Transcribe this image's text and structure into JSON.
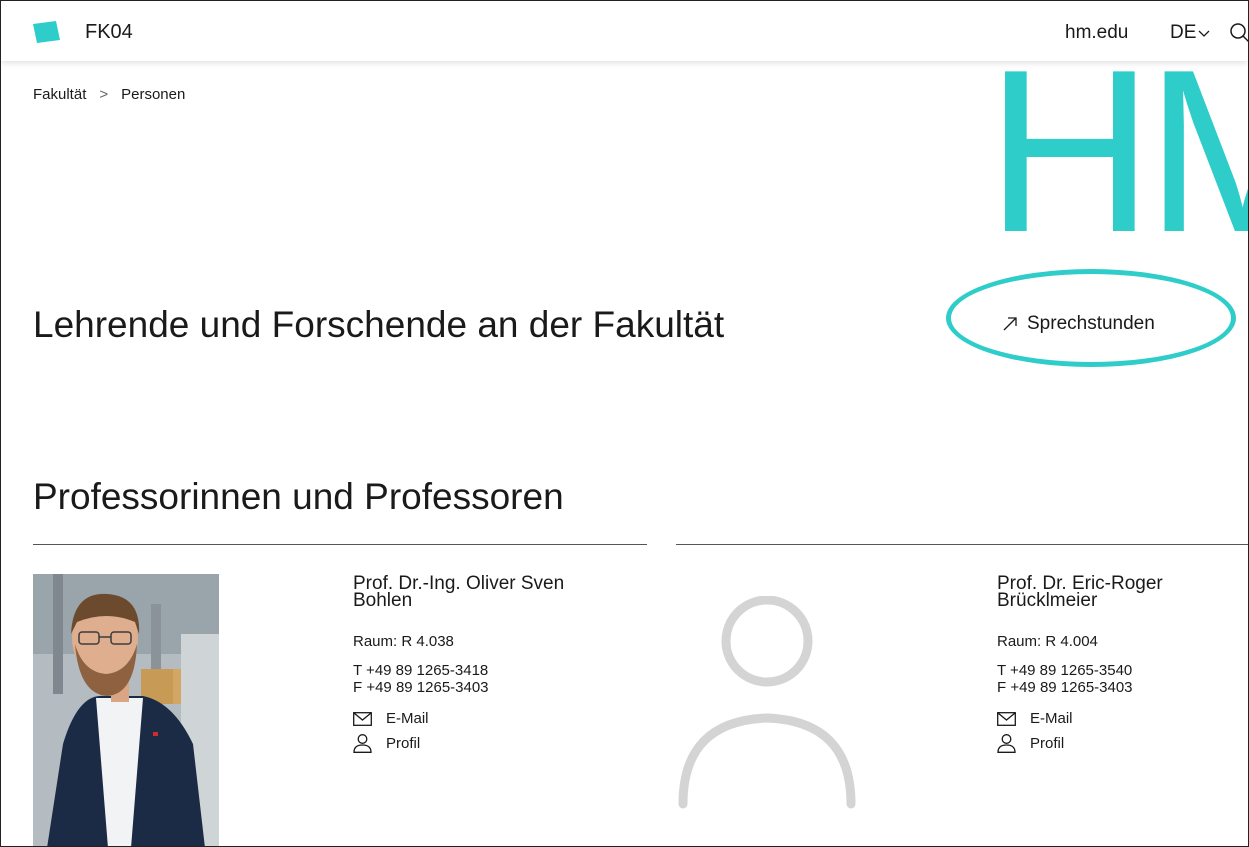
{
  "header": {
    "site_name": "FK04",
    "hm_link": "hm.edu",
    "language": "DE",
    "brand_color": "#2fcdc9",
    "icons": [
      "logo-square-icon",
      "chevron-down-icon",
      "search-icon"
    ]
  },
  "breadcrumb": {
    "items": [
      "Fakultät",
      "Personen"
    ],
    "separator": ">"
  },
  "hero": {
    "brand_text": "HM"
  },
  "page": {
    "title": "Lehrende und Forschende an der Fakultät",
    "sprechstunden_link": "Sprechstunden",
    "section_title": "Professorinnen und Professoren"
  },
  "people": [
    {
      "name": "Prof. Dr.-Ing. Oliver Sven Bohlen",
      "room": "Raum: R 4.038",
      "phone": "T +49 89 1265-3418",
      "fax": "F +49 89 1265-3403",
      "email_label": "E-Mail",
      "profile_label": "Profil",
      "has_photo": true
    },
    {
      "name": "Prof. Dr. Eric-Roger Brücklmeier",
      "room": "Raum: R 4.004",
      "phone": "T +49 89 1265-3540",
      "fax": "F +49 89 1265-3403",
      "email_label": "E-Mail",
      "profile_label": "Profil",
      "has_photo": false
    }
  ]
}
